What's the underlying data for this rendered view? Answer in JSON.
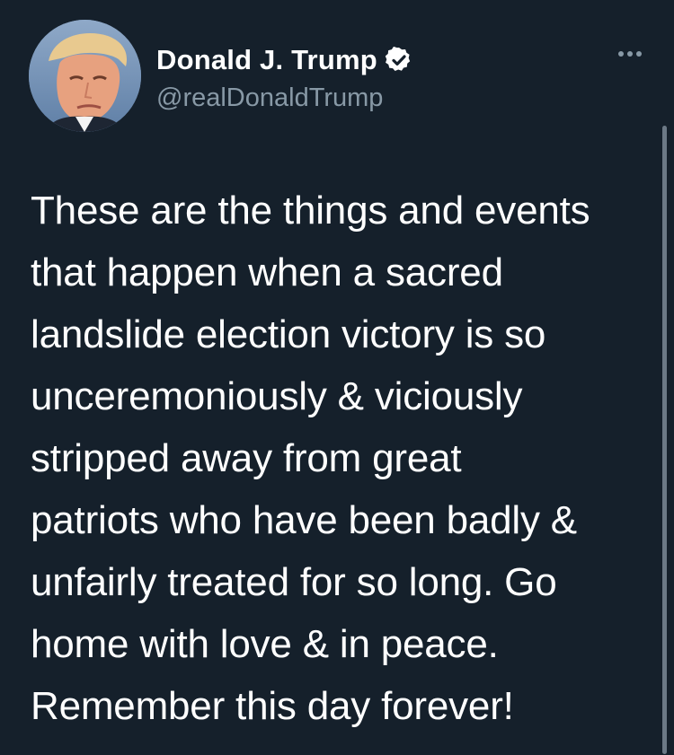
{
  "tweet": {
    "author": {
      "display_name": "Donald J. Trump",
      "handle": "@realDonaldTrump",
      "verified_icon": "verified-badge-icon",
      "avatar_icon": "profile-photo"
    },
    "more_icon": "more-options-icon",
    "text_lines": [
      "These are the things and events",
      "that happen when a sacred",
      "landslide election victory is so",
      "unceremoniously & viciously",
      "stripped away from great",
      "patriots who have been badly &",
      "unfairly treated for so long. Go",
      "home with love & in peace.",
      "Remember this day forever!"
    ]
  },
  "colors": {
    "background": "#15202b",
    "text": "#ffffff",
    "secondary_text": "#8899a6",
    "verified_badge": "#ffffff"
  }
}
